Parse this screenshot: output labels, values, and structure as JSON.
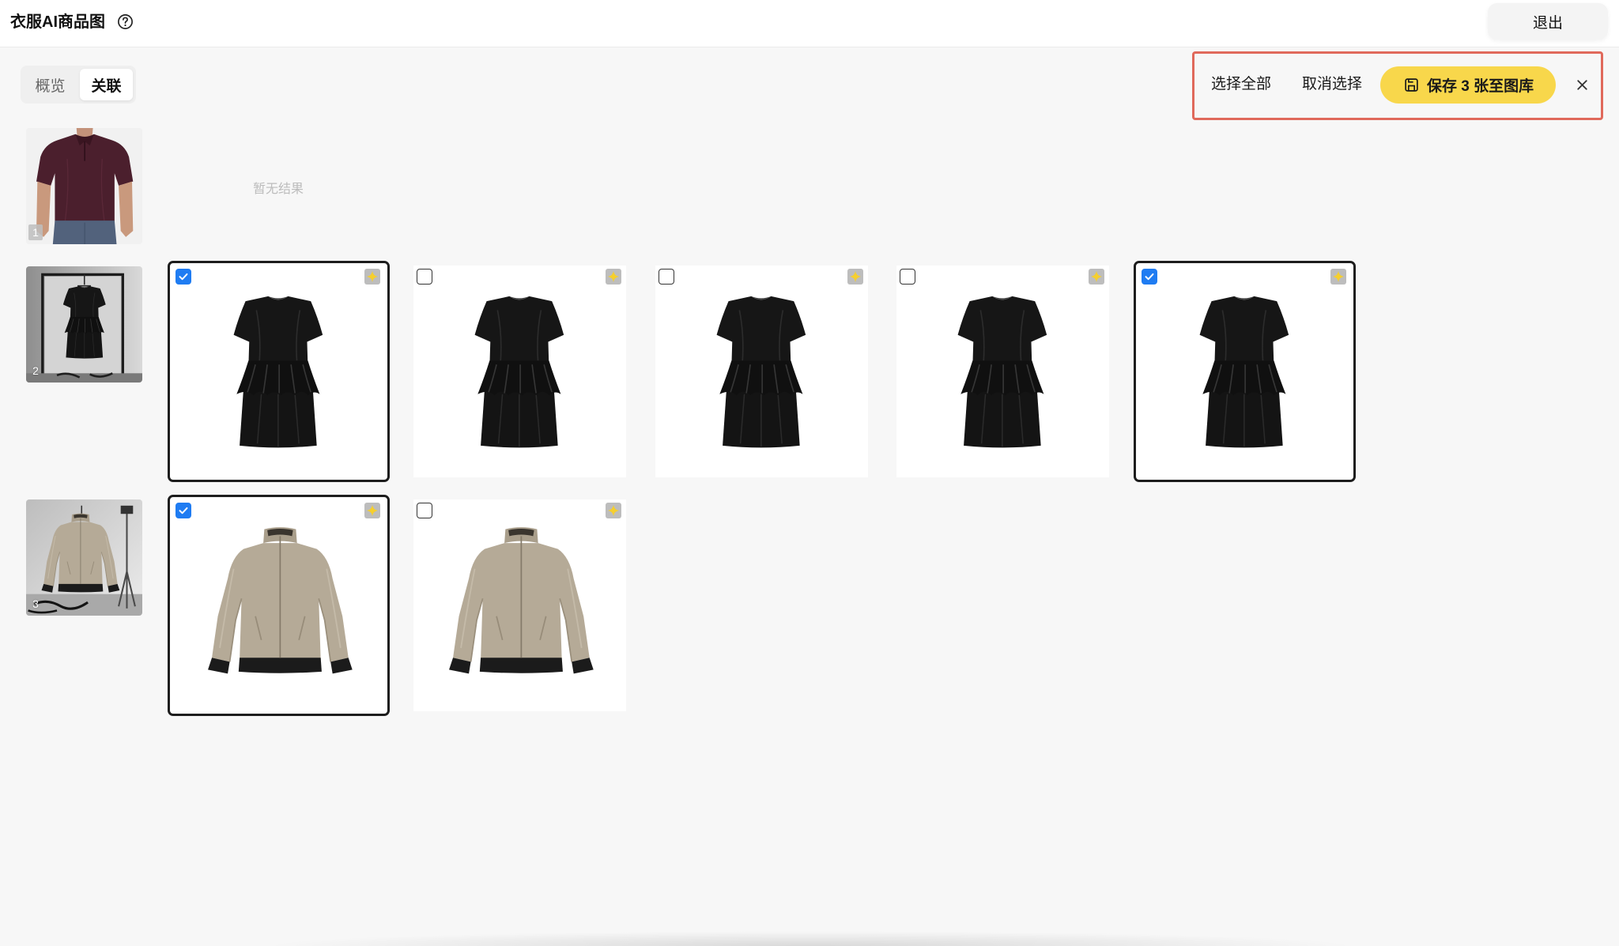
{
  "header": {
    "title": "衣服AI商品图",
    "help_icon": "help-circle-icon",
    "exit_label": "退出"
  },
  "tabs": [
    {
      "label": "概览",
      "active": false
    },
    {
      "label": "关联",
      "active": true
    }
  ],
  "selection_bar": {
    "select_all_label": "选择全部",
    "deselect_label": "取消选择",
    "save_icon": "save-icon",
    "save_label": "保存 3 张至图库",
    "close_icon": "close-icon"
  },
  "colors": {
    "save_button": "#f8d74b",
    "checkbox_checked": "#1f7cf2",
    "selected_border": "#1d1d1d",
    "highlight_outline": "#e0695b",
    "page_background": "#f7f7f7"
  },
  "rows": [
    {
      "index": "1",
      "empty_text": "暂无结果",
      "results": []
    },
    {
      "index": "2",
      "results": [
        {
          "selected": true,
          "badge_icon": "sparkle-icon"
        },
        {
          "selected": false,
          "badge_icon": "sparkle-icon"
        },
        {
          "selected": false,
          "badge_icon": "sparkle-icon"
        },
        {
          "selected": false,
          "badge_icon": "sparkle-icon"
        },
        {
          "selected": true,
          "badge_icon": "sparkle-icon"
        }
      ]
    },
    {
      "index": "3",
      "results": [
        {
          "selected": true,
          "badge_icon": "sparkle-icon"
        },
        {
          "selected": false,
          "badge_icon": "sparkle-icon"
        }
      ]
    }
  ]
}
